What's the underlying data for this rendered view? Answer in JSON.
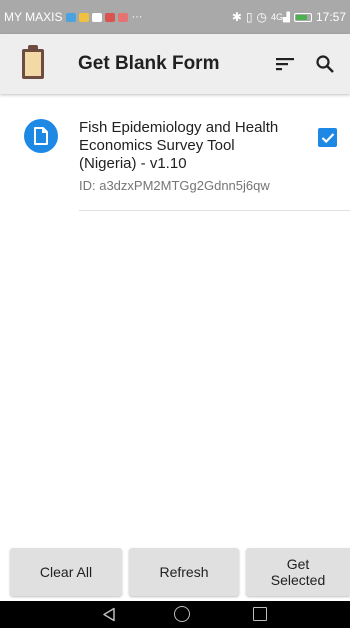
{
  "status_bar": {
    "carrier": "MY MAXIS",
    "time": "17:57",
    "signal_label": "4G"
  },
  "toolbar": {
    "title": "Get Blank Form",
    "app_icon": "clipboard-icon",
    "sort_icon": "sort-icon",
    "search_icon": "search-icon"
  },
  "forms": [
    {
      "title": "Fish Epidemiology and Health Economics Survey Tool (Nigeria) - v1.10",
      "id_text": "ID: a3dzxPM2MTGg2Gdnn5j6qw",
      "checked": true
    }
  ],
  "buttons": {
    "clear_all": "Clear All",
    "refresh": "Refresh",
    "get_selected_line1": "Get",
    "get_selected_line2": "Selected"
  },
  "colors": {
    "accent": "#1e88e5",
    "toolbar_bg": "#eeeeee",
    "status_bar_bg": "#a9a9a9"
  }
}
